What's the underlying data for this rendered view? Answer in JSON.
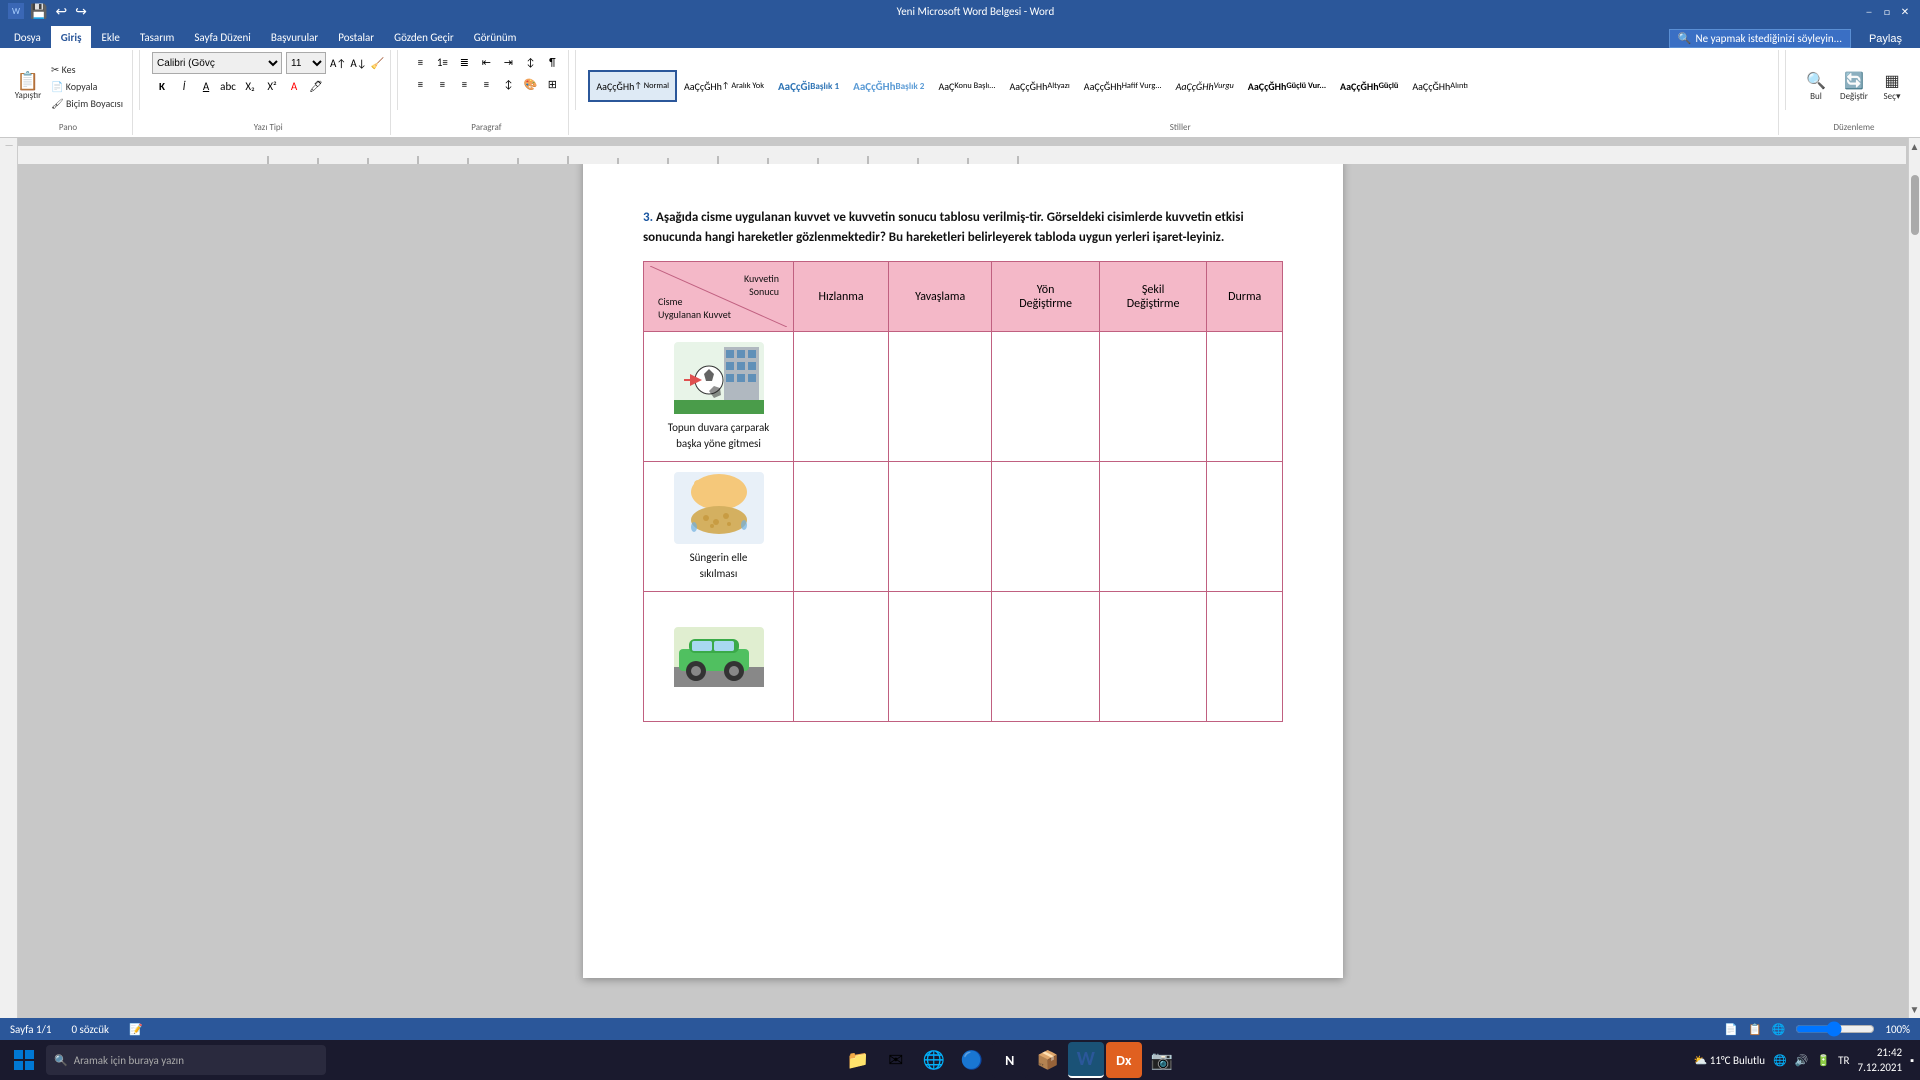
{
  "titlebar": {
    "title": "Yeni Microsoft Word Belgesi - Word",
    "quickaccess": [
      "💾",
      "↩",
      "↪"
    ],
    "controls": [
      "─",
      "□",
      "✕"
    ]
  },
  "ribbon": {
    "tabs": [
      "Dosya",
      "Giriş",
      "Ekle",
      "Tasarım",
      "Sayfa Düzeni",
      "Başvurular",
      "Postalar",
      "Gözden Geçir",
      "Görünüm"
    ],
    "active_tab": "Giriş",
    "search_placeholder": "Ne yapmak istediğinizi söyleyin...",
    "share_label": "Paylaş",
    "groups": {
      "pano": {
        "label": "Pano",
        "buttons": [
          "Yapıştır",
          "Kes",
          "Kopyala",
          "Biçim Boyacısı"
        ]
      },
      "yazi_tipi": {
        "label": "Yazı Tipi",
        "font": "Calibri (Gövç",
        "size": "11"
      },
      "paragraf": {
        "label": "Paragraf"
      },
      "stiller": {
        "label": "Stiller",
        "items": [
          "Normal",
          "Aralık Yok",
          "Başlık 1",
          "Başlık 2",
          "Konu Başlı...",
          "Altyazı",
          "Hafif Vurg...",
          "Vurgu",
          "Güçlü Vur...",
          "Güçlü",
          "Alıntı"
        ]
      },
      "duzenleme": {
        "label": "Düzenleme",
        "buttons": [
          "Bul",
          "Değiştir",
          "Seç"
        ]
      }
    }
  },
  "document": {
    "question": {
      "number": "3.",
      "text": " Aşağıda cisme uygulanan kuvvet ve kuvvetin sonucu tablosu verilmiş-tir. Görseldeki cisimlerde kuvvetin etkisi sonucunda hangi hareketler gözlenmektedir? Bu hareketleri belirleyerek tabloda uygun yerleri işaret-leyiniz."
    },
    "table": {
      "header": {
        "diagonal_top": "Kuvvetin\nSonucu",
        "diagonal_bottom": "Cisme\nUygulanan Kuvvet",
        "columns": [
          "Hızlanma",
          "Yavaşlama",
          "Yön\nDeğiştirme",
          "Şekil\nDeğiştirme",
          "Durma"
        ]
      },
      "rows": [
        {
          "label": "Topun duvara çarparak\nbaşka yöne gitmesi",
          "image_type": "soccer_ball"
        },
        {
          "label": "Süngerin elle\nsıkılması",
          "image_type": "sponge"
        },
        {
          "label": "",
          "image_type": "car"
        }
      ]
    }
  },
  "statusbar": {
    "page": "Sayfa 1/1",
    "words": "0 sözcük",
    "view_icons": [
      "📄",
      "📋",
      "📊"
    ],
    "zoom": "100%"
  },
  "taskbar": {
    "search_placeholder": "Aramak için buraya yazın",
    "apps": [
      "⊞",
      "🔍",
      "📁",
      "✉",
      "🌐",
      "N",
      "📦",
      "W",
      "📷"
    ],
    "tray": {
      "time": "21:42",
      "date": "7.12.2021",
      "weather": "11°C Bulutlu"
    }
  }
}
